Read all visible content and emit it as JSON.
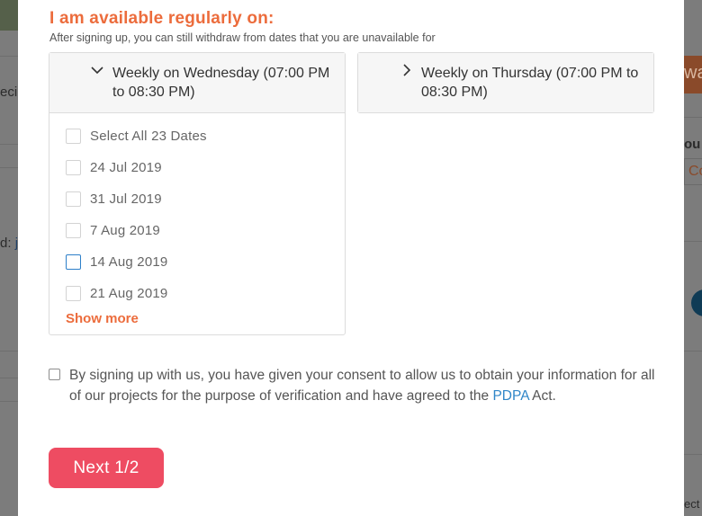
{
  "background": {
    "fragments": [
      "eci",
      "d: ",
      "jo",
      "wa",
      "ou",
      "Co",
      "ect"
    ]
  },
  "modal": {
    "availability_title": "I am available regularly on:",
    "availability_subtitle": "After signing up, you can still withdraw from dates that you are unavailable for",
    "schedules": [
      {
        "title": "Weekly on Wednesday (07:00 PM to 08:30 PM)",
        "expanded": true,
        "chevron_icon": "chevron-down-icon",
        "select_all_label": "Select All 23 Dates",
        "dates": [
          "24 Jul 2019",
          "31 Jul 2019",
          "7 Aug 2019",
          "14 Aug 2019",
          "21 Aug 2019"
        ],
        "show_more_label": "Show more"
      },
      {
        "title": "Weekly on Thursday (07:00 PM to 08:30 PM)",
        "expanded": false,
        "chevron_icon": "chevron-right-icon"
      }
    ],
    "consent": {
      "text_before": "By signing up with us, you have given your consent to allow us to obtain your information for all of our projects for the purpose of verification and have agreed to the ",
      "link_text": "PDPA",
      "text_after": " Act.",
      "checked": false
    },
    "next_button_label": "Next 1/2"
  },
  "colors": {
    "accent_orange": "#ec6c3c",
    "button_red": "#ee4c62",
    "link_blue": "#2f86c8",
    "focus_blue": "#2d7fc9"
  }
}
